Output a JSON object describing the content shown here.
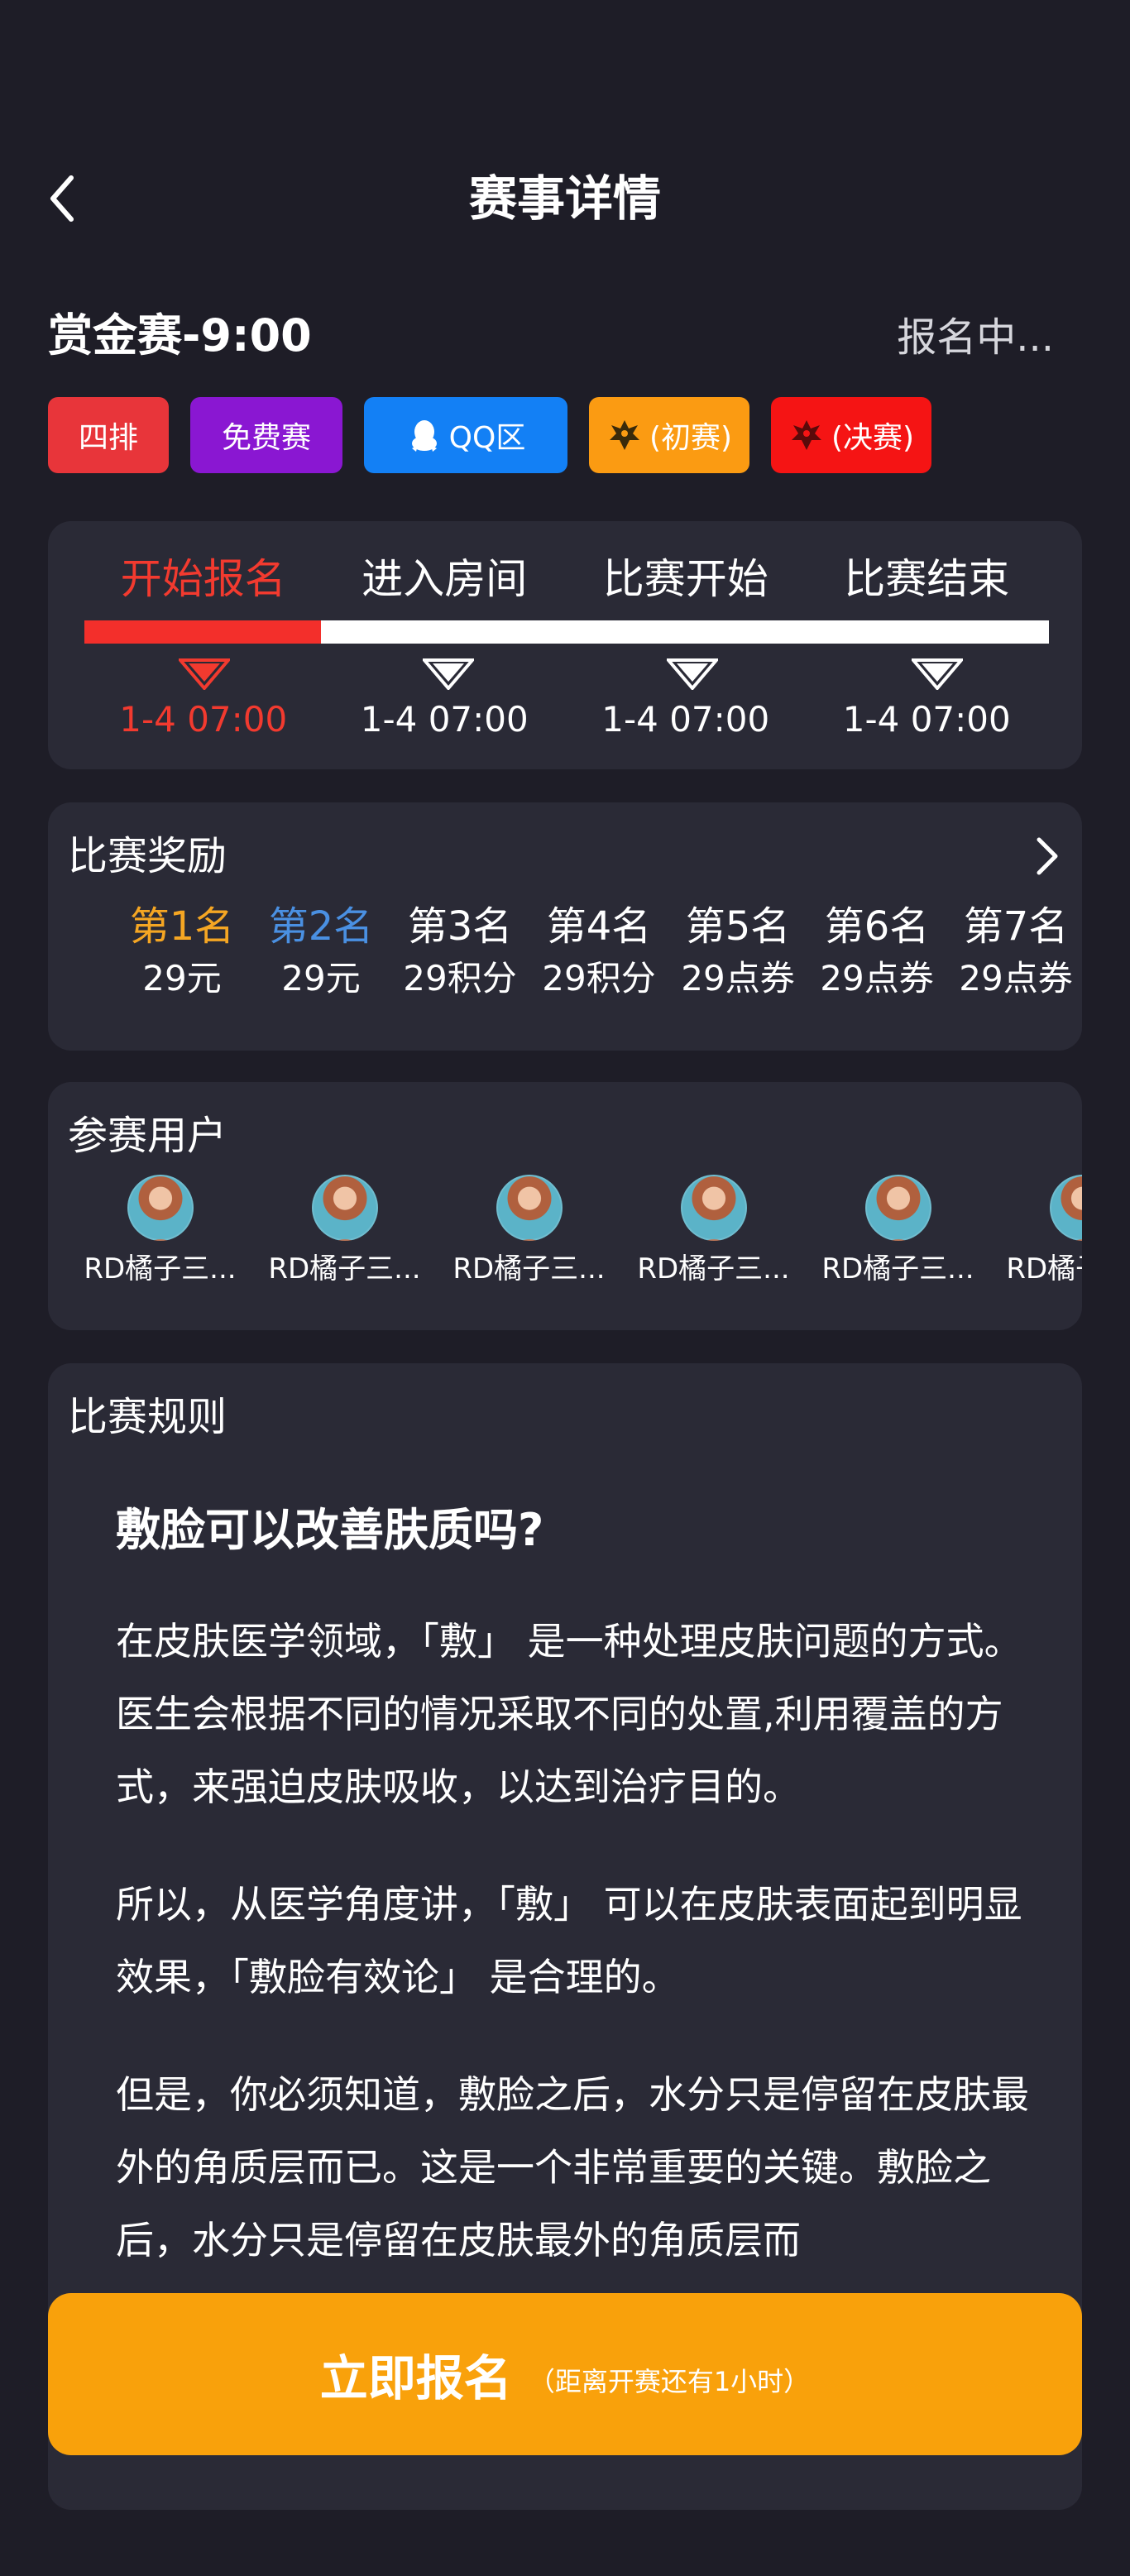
{
  "header": {
    "title": "赛事详情",
    "back_icon": "chevron-left-icon"
  },
  "match": {
    "title": "赏金赛-9:00",
    "status": "报名中..."
  },
  "tags": [
    {
      "label": "四排",
      "color": "#e8353a",
      "icon": ""
    },
    {
      "label": "免费赛",
      "color": "#8a17d2",
      "icon": ""
    },
    {
      "label": "QQ区",
      "color": "#1380f5",
      "icon": "qq-penguin-icon"
    },
    {
      "label": "(初赛)",
      "color": "#fb9b12",
      "icon": "dragon-icon"
    },
    {
      "label": "(决赛)",
      "color": "#f51414",
      "icon": "dragon-icon"
    }
  ],
  "timeline": {
    "progress": 0.245,
    "steps": [
      {
        "label": "开始报名",
        "date": "1-4 07:00",
        "active": true
      },
      {
        "label": "进入房间",
        "date": "1-4 07:00",
        "active": false
      },
      {
        "label": "比赛开始",
        "date": "1-4 07:00",
        "active": false
      },
      {
        "label": "比赛结束",
        "date": "1-4 07:00",
        "active": false
      }
    ]
  },
  "rewards": {
    "title": "比赛奖励",
    "items": [
      {
        "rank": "第1名",
        "prize": "29元",
        "color": "#f5a623"
      },
      {
        "rank": "第2名",
        "prize": "29元",
        "color": "#4a90e2"
      },
      {
        "rank": "第3名",
        "prize": "29积分",
        "color": "#ffffff"
      },
      {
        "rank": "第4名",
        "prize": "29积分",
        "color": "#ffffff"
      },
      {
        "rank": "第5名",
        "prize": "29点券",
        "color": "#ffffff"
      },
      {
        "rank": "第6名",
        "prize": "29点券",
        "color": "#ffffff"
      },
      {
        "rank": "第7名",
        "prize": "29点券",
        "color": "#ffffff"
      }
    ]
  },
  "participants": {
    "title": "参赛用户",
    "users": [
      {
        "name": "RD橘子三..."
      },
      {
        "name": "RD橘子三..."
      },
      {
        "name": "RD橘子三..."
      },
      {
        "name": "RD橘子三..."
      },
      {
        "name": "RD橘子三..."
      },
      {
        "name": "RD橘子三..."
      }
    ]
  },
  "rules": {
    "title": "比赛规则",
    "heading": "敷脸可以改善肤质吗?",
    "paragraphs": [
      "在皮肤医学领域，「敷」 是一种处理皮肤问题的方式。医生会根据不同的情况采取不同的处置,利用覆盖的方式，来强迫皮肤吸收，以达到治疗目的。",
      "所以，从医学角度讲，「敷」 可以在皮肤表面起到明显效果，「敷脸有效论」 是合理的。",
      "但是，你必须知道，敷脸之后，水分只是停留在皮肤最外的角质层而已。这是一个非常重要的关键。敷脸之后，水分只是停留在皮肤最外的角质层而"
    ]
  },
  "cta": {
    "label": "立即报名",
    "sub": "（距离开赛还有1小时）",
    "color": "#f9a10b"
  }
}
